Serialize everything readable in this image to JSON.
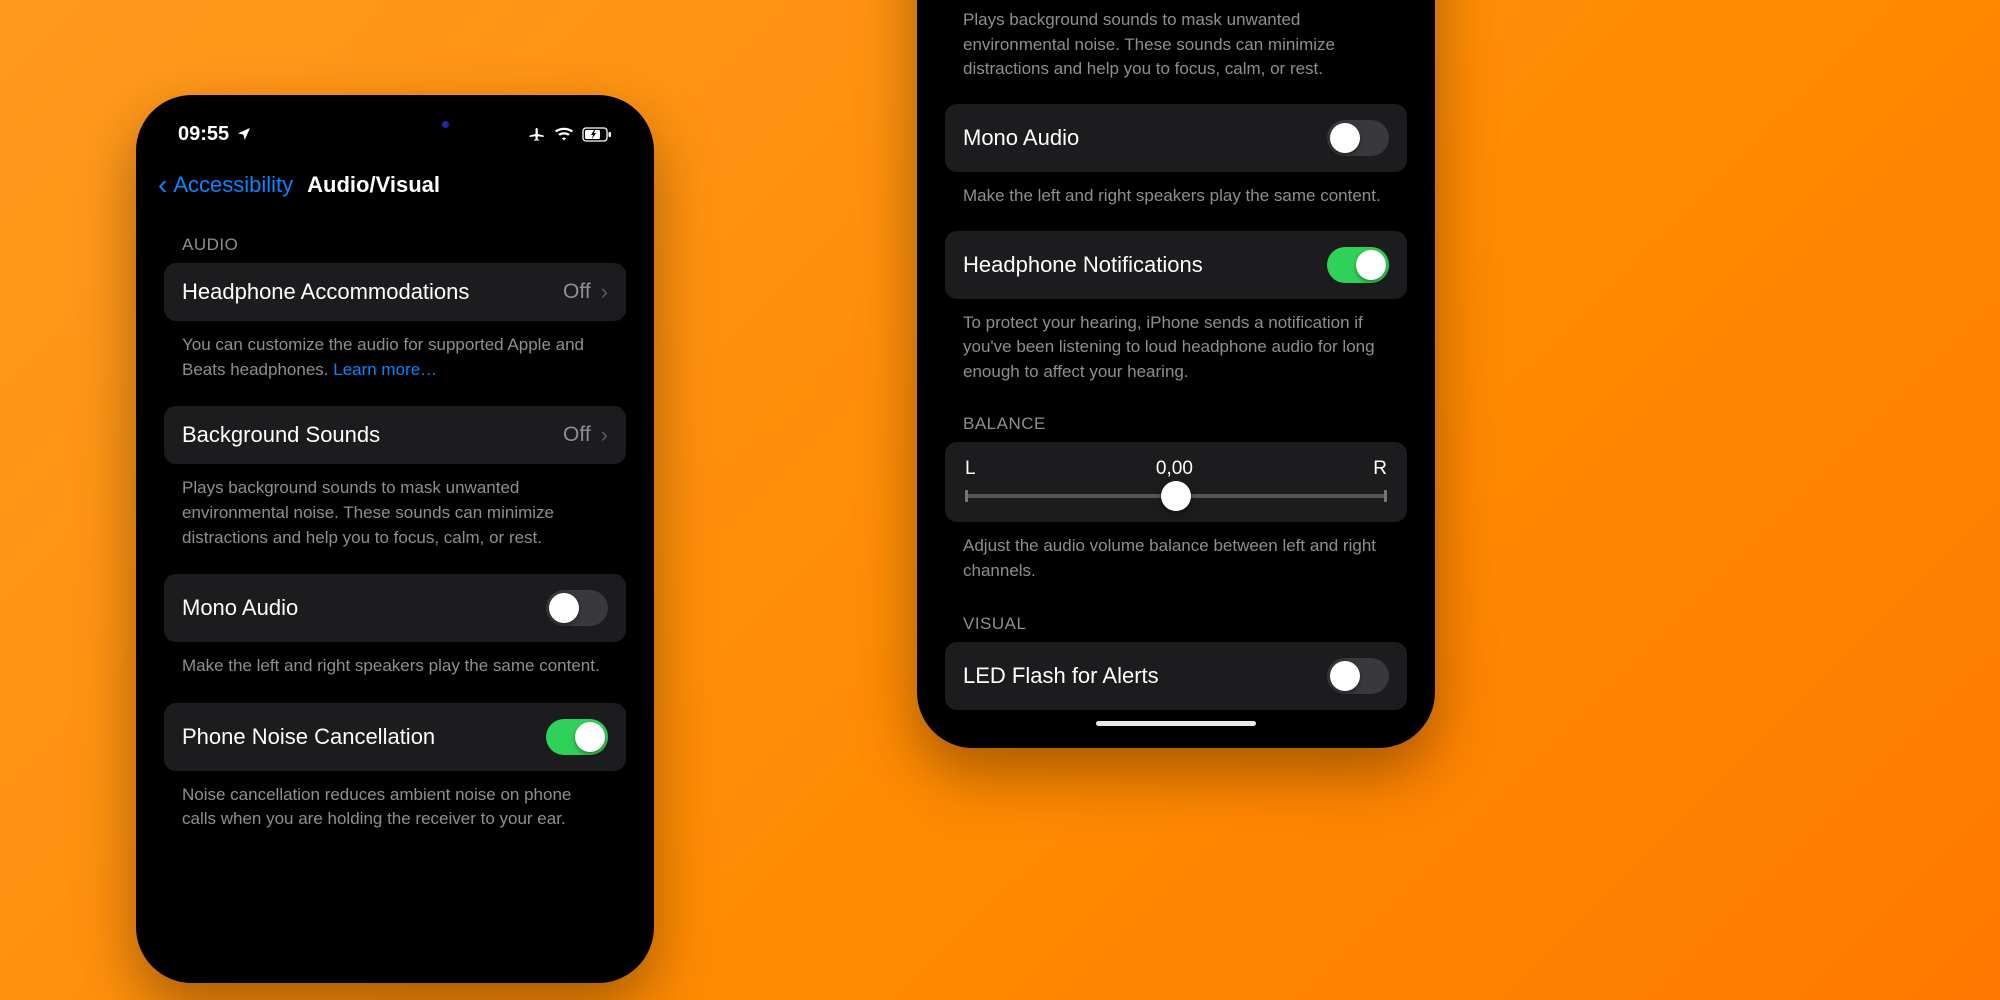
{
  "colors": {
    "accent": "#0a84ff",
    "toggle_on": "#30d158"
  },
  "device1": {
    "status": {
      "time": "09:55"
    },
    "nav": {
      "back": "Accessibility",
      "title": "Audio/Visual"
    },
    "audio_header": "AUDIO",
    "headphone_accommodations": {
      "label": "Headphone Accommodations",
      "value": "Off"
    },
    "headphone_accommodations_footer": {
      "text": "You can customize the audio for supported Apple and Beats headphones. ",
      "link": "Learn more…"
    },
    "background_sounds": {
      "label": "Background Sounds",
      "value": "Off"
    },
    "background_sounds_footer": "Plays background sounds to mask unwanted environmental noise. These sounds can minimize distractions and help you to focus, calm, or rest.",
    "mono_audio": {
      "label": "Mono Audio",
      "on": false
    },
    "mono_audio_footer": "Make the left and right speakers play the same content.",
    "phone_noise_cancellation": {
      "label": "Phone Noise Cancellation",
      "on": true
    },
    "phone_noise_cancellation_footer": "Noise cancellation reduces ambient noise on phone calls when you are holding the receiver to your ear."
  },
  "device2": {
    "background_sounds_footer": "Plays background sounds to mask unwanted environmental noise. These sounds can minimize distractions and help you to focus, calm, or rest.",
    "mono_audio": {
      "label": "Mono Audio",
      "on": false
    },
    "mono_audio_footer": "Make the left and right speakers play the same content.",
    "headphone_notifications": {
      "label": "Headphone Notifications",
      "on": true
    },
    "headphone_notifications_footer": "To protect your hearing, iPhone sends a notification if you've been listening to loud headphone audio for long enough to affect your hearing.",
    "balance_header": "BALANCE",
    "balance": {
      "left_label": "L",
      "right_label": "R",
      "value_text": "0,00",
      "value": 0.0
    },
    "balance_footer": "Adjust the audio volume balance between left and right channels.",
    "visual_header": "VISUAL",
    "led_flash": {
      "label": "LED Flash for Alerts",
      "on": false
    }
  }
}
